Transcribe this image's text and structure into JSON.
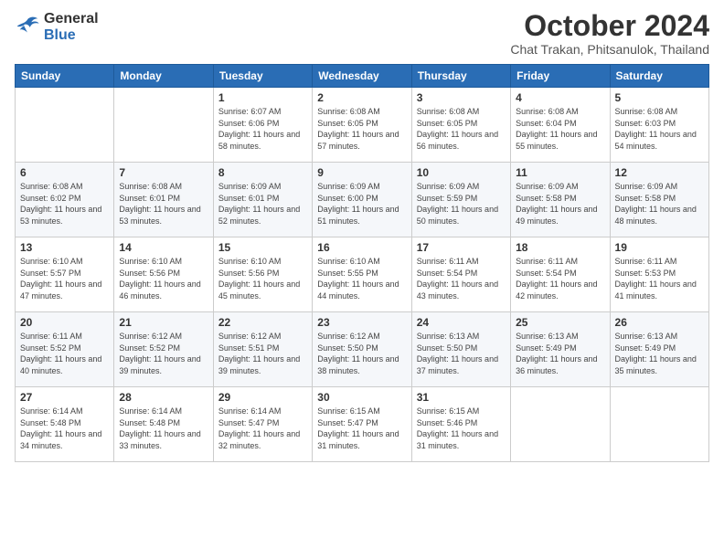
{
  "logo": {
    "line1": "General",
    "line2": "Blue"
  },
  "header": {
    "month": "October 2024",
    "location": "Chat Trakan, Phitsanulok, Thailand"
  },
  "weekdays": [
    "Sunday",
    "Monday",
    "Tuesday",
    "Wednesday",
    "Thursday",
    "Friday",
    "Saturday"
  ],
  "weeks": [
    [
      {
        "day": null,
        "content": null
      },
      {
        "day": null,
        "content": null
      },
      {
        "day": "1",
        "content": "Sunrise: 6:07 AM\nSunset: 6:06 PM\nDaylight: 11 hours and 58 minutes."
      },
      {
        "day": "2",
        "content": "Sunrise: 6:08 AM\nSunset: 6:05 PM\nDaylight: 11 hours and 57 minutes."
      },
      {
        "day": "3",
        "content": "Sunrise: 6:08 AM\nSunset: 6:05 PM\nDaylight: 11 hours and 56 minutes."
      },
      {
        "day": "4",
        "content": "Sunrise: 6:08 AM\nSunset: 6:04 PM\nDaylight: 11 hours and 55 minutes."
      },
      {
        "day": "5",
        "content": "Sunrise: 6:08 AM\nSunset: 6:03 PM\nDaylight: 11 hours and 54 minutes."
      }
    ],
    [
      {
        "day": "6",
        "content": "Sunrise: 6:08 AM\nSunset: 6:02 PM\nDaylight: 11 hours and 53 minutes."
      },
      {
        "day": "7",
        "content": "Sunrise: 6:08 AM\nSunset: 6:01 PM\nDaylight: 11 hours and 53 minutes."
      },
      {
        "day": "8",
        "content": "Sunrise: 6:09 AM\nSunset: 6:01 PM\nDaylight: 11 hours and 52 minutes."
      },
      {
        "day": "9",
        "content": "Sunrise: 6:09 AM\nSunset: 6:00 PM\nDaylight: 11 hours and 51 minutes."
      },
      {
        "day": "10",
        "content": "Sunrise: 6:09 AM\nSunset: 5:59 PM\nDaylight: 11 hours and 50 minutes."
      },
      {
        "day": "11",
        "content": "Sunrise: 6:09 AM\nSunset: 5:58 PM\nDaylight: 11 hours and 49 minutes."
      },
      {
        "day": "12",
        "content": "Sunrise: 6:09 AM\nSunset: 5:58 PM\nDaylight: 11 hours and 48 minutes."
      }
    ],
    [
      {
        "day": "13",
        "content": "Sunrise: 6:10 AM\nSunset: 5:57 PM\nDaylight: 11 hours and 47 minutes."
      },
      {
        "day": "14",
        "content": "Sunrise: 6:10 AM\nSunset: 5:56 PM\nDaylight: 11 hours and 46 minutes."
      },
      {
        "day": "15",
        "content": "Sunrise: 6:10 AM\nSunset: 5:56 PM\nDaylight: 11 hours and 45 minutes."
      },
      {
        "day": "16",
        "content": "Sunrise: 6:10 AM\nSunset: 5:55 PM\nDaylight: 11 hours and 44 minutes."
      },
      {
        "day": "17",
        "content": "Sunrise: 6:11 AM\nSunset: 5:54 PM\nDaylight: 11 hours and 43 minutes."
      },
      {
        "day": "18",
        "content": "Sunrise: 6:11 AM\nSunset: 5:54 PM\nDaylight: 11 hours and 42 minutes."
      },
      {
        "day": "19",
        "content": "Sunrise: 6:11 AM\nSunset: 5:53 PM\nDaylight: 11 hours and 41 minutes."
      }
    ],
    [
      {
        "day": "20",
        "content": "Sunrise: 6:11 AM\nSunset: 5:52 PM\nDaylight: 11 hours and 40 minutes."
      },
      {
        "day": "21",
        "content": "Sunrise: 6:12 AM\nSunset: 5:52 PM\nDaylight: 11 hours and 39 minutes."
      },
      {
        "day": "22",
        "content": "Sunrise: 6:12 AM\nSunset: 5:51 PM\nDaylight: 11 hours and 39 minutes."
      },
      {
        "day": "23",
        "content": "Sunrise: 6:12 AM\nSunset: 5:50 PM\nDaylight: 11 hours and 38 minutes."
      },
      {
        "day": "24",
        "content": "Sunrise: 6:13 AM\nSunset: 5:50 PM\nDaylight: 11 hours and 37 minutes."
      },
      {
        "day": "25",
        "content": "Sunrise: 6:13 AM\nSunset: 5:49 PM\nDaylight: 11 hours and 36 minutes."
      },
      {
        "day": "26",
        "content": "Sunrise: 6:13 AM\nSunset: 5:49 PM\nDaylight: 11 hours and 35 minutes."
      }
    ],
    [
      {
        "day": "27",
        "content": "Sunrise: 6:14 AM\nSunset: 5:48 PM\nDaylight: 11 hours and 34 minutes."
      },
      {
        "day": "28",
        "content": "Sunrise: 6:14 AM\nSunset: 5:48 PM\nDaylight: 11 hours and 33 minutes."
      },
      {
        "day": "29",
        "content": "Sunrise: 6:14 AM\nSunset: 5:47 PM\nDaylight: 11 hours and 32 minutes."
      },
      {
        "day": "30",
        "content": "Sunrise: 6:15 AM\nSunset: 5:47 PM\nDaylight: 11 hours and 31 minutes."
      },
      {
        "day": "31",
        "content": "Sunrise: 6:15 AM\nSunset: 5:46 PM\nDaylight: 11 hours and 31 minutes."
      },
      {
        "day": null,
        "content": null
      },
      {
        "day": null,
        "content": null
      }
    ]
  ]
}
